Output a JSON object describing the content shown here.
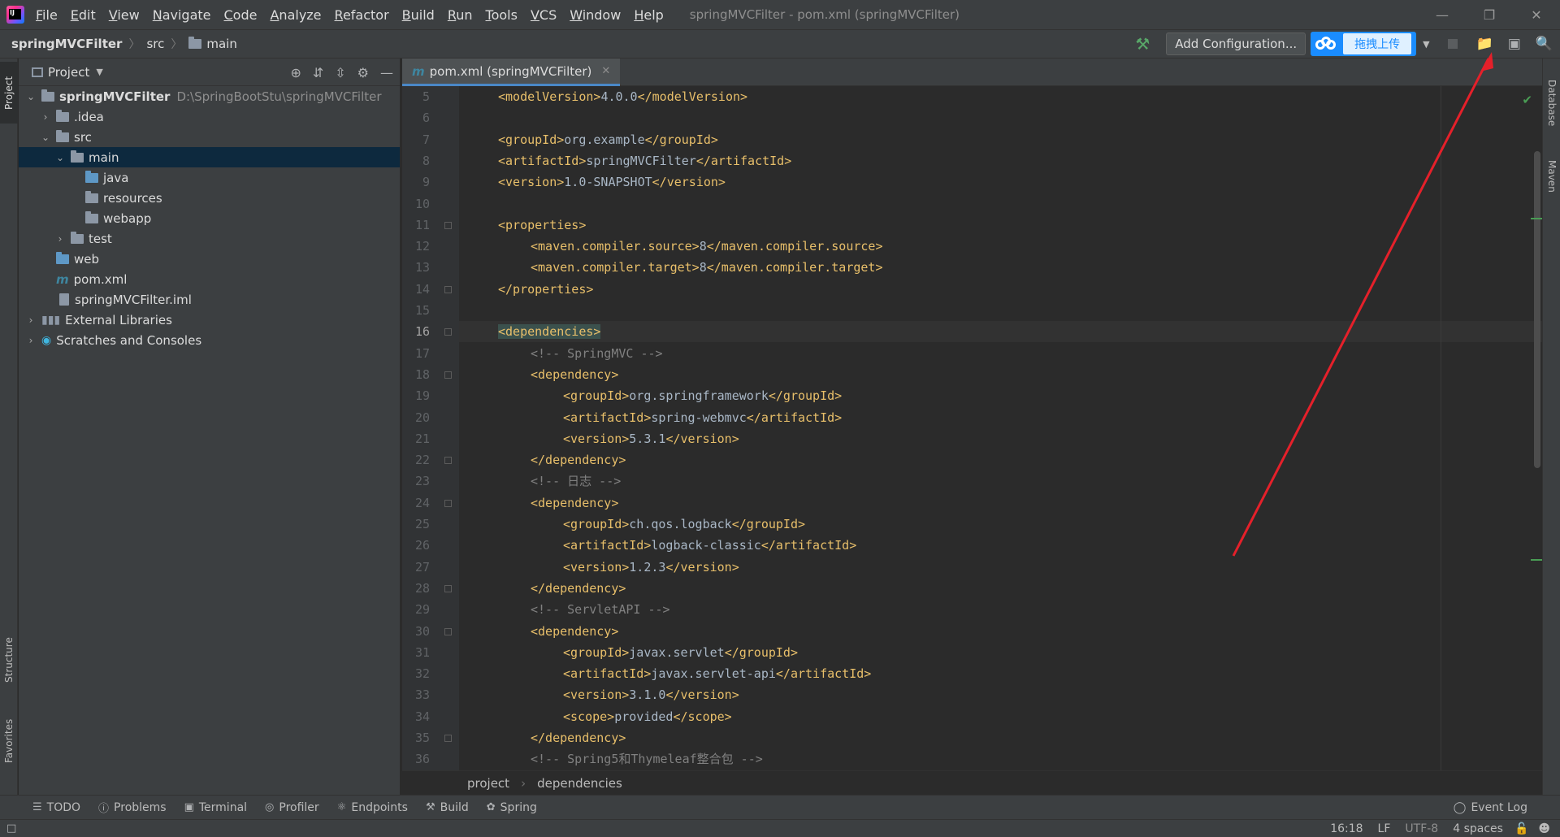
{
  "menu": {
    "items": [
      "File",
      "Edit",
      "View",
      "Navigate",
      "Code",
      "Analyze",
      "Refactor",
      "Build",
      "Run",
      "Tools",
      "VCS",
      "Window",
      "Help"
    ],
    "window_title": "springMVCFilter - pom.xml (springMVCFilter)"
  },
  "nav": {
    "project": "springMVCFilter",
    "src": "src",
    "main": "main"
  },
  "toolbar": {
    "add_config": "Add Configuration...",
    "baidu_upload": "拖拽上传"
  },
  "project_panel": {
    "title": "Project",
    "tree": [
      {
        "label": "springMVCFilter",
        "hint": "D:\\SpringBootStu\\springMVCFilter"
      },
      {
        "label": ".idea"
      },
      {
        "label": "src"
      },
      {
        "label": "main"
      },
      {
        "label": "java"
      },
      {
        "label": "resources"
      },
      {
        "label": "webapp"
      },
      {
        "label": "test"
      },
      {
        "label": "web"
      },
      {
        "label": "pom.xml"
      },
      {
        "label": "springMVCFilter.iml"
      },
      {
        "label": "External Libraries"
      },
      {
        "label": "Scratches and Consoles"
      }
    ]
  },
  "editor": {
    "tab": "pom.xml (springMVCFilter)",
    "current_line": 16,
    "lines": [
      {
        "n": "5",
        "indent": 1,
        "parts": [
          [
            "tag",
            "<modelVersion>"
          ],
          [
            "txt",
            "4.0.0"
          ],
          [
            "tag",
            "</modelVersion>"
          ]
        ]
      },
      {
        "n": "6",
        "indent": 0,
        "parts": []
      },
      {
        "n": "7",
        "indent": 1,
        "parts": [
          [
            "tag",
            "<groupId>"
          ],
          [
            "txt",
            "org.example"
          ],
          [
            "tag",
            "</groupId>"
          ]
        ]
      },
      {
        "n": "8",
        "indent": 1,
        "parts": [
          [
            "tag",
            "<artifactId>"
          ],
          [
            "txt",
            "springMVCFilter"
          ],
          [
            "tag",
            "</artifactId>"
          ]
        ]
      },
      {
        "n": "9",
        "indent": 1,
        "parts": [
          [
            "tag",
            "<version>"
          ],
          [
            "txt",
            "1.0-SNAPSHOT"
          ],
          [
            "tag",
            "</version>"
          ]
        ]
      },
      {
        "n": "10",
        "indent": 0,
        "parts": []
      },
      {
        "n": "11",
        "indent": 1,
        "parts": [
          [
            "tag",
            "<properties>"
          ]
        ]
      },
      {
        "n": "12",
        "indent": 2,
        "parts": [
          [
            "tag",
            "<maven.compiler.source>"
          ],
          [
            "txt",
            "8"
          ],
          [
            "tag",
            "</maven.compiler.source>"
          ]
        ]
      },
      {
        "n": "13",
        "indent": 2,
        "parts": [
          [
            "tag",
            "<maven.compiler.target>"
          ],
          [
            "txt",
            "8"
          ],
          [
            "tag",
            "</maven.compiler.target>"
          ]
        ]
      },
      {
        "n": "14",
        "indent": 1,
        "parts": [
          [
            "tag",
            "</properties>"
          ]
        ]
      },
      {
        "n": "15",
        "indent": 0,
        "parts": []
      },
      {
        "n": "16",
        "indent": 1,
        "parts": [
          [
            "taghl",
            "<dependencies>"
          ]
        ]
      },
      {
        "n": "17",
        "indent": 2,
        "parts": [
          [
            "cmt",
            "<!-- SpringMVC -->"
          ]
        ]
      },
      {
        "n": "18",
        "indent": 2,
        "parts": [
          [
            "tag",
            "<dependency>"
          ]
        ]
      },
      {
        "n": "19",
        "indent": 3,
        "parts": [
          [
            "tag",
            "<groupId>"
          ],
          [
            "txt",
            "org.springframework"
          ],
          [
            "tag",
            "</groupId>"
          ]
        ]
      },
      {
        "n": "20",
        "indent": 3,
        "parts": [
          [
            "tag",
            "<artifactId>"
          ],
          [
            "txt",
            "spring-webmvc"
          ],
          [
            "tag",
            "</artifactId>"
          ]
        ]
      },
      {
        "n": "21",
        "indent": 3,
        "parts": [
          [
            "tag",
            "<version>"
          ],
          [
            "txt",
            "5.3.1"
          ],
          [
            "tag",
            "</version>"
          ]
        ]
      },
      {
        "n": "22",
        "indent": 2,
        "parts": [
          [
            "tag",
            "</dependency>"
          ]
        ]
      },
      {
        "n": "23",
        "indent": 2,
        "parts": [
          [
            "cmt",
            "<!-- 日志 -->"
          ]
        ]
      },
      {
        "n": "24",
        "indent": 2,
        "parts": [
          [
            "tag",
            "<dependency>"
          ]
        ]
      },
      {
        "n": "25",
        "indent": 3,
        "parts": [
          [
            "tag",
            "<groupId>"
          ],
          [
            "txt",
            "ch.qos.logback"
          ],
          [
            "tag",
            "</groupId>"
          ]
        ]
      },
      {
        "n": "26",
        "indent": 3,
        "parts": [
          [
            "tag",
            "<artifactId>"
          ],
          [
            "txt",
            "logback-classic"
          ],
          [
            "tag",
            "</artifactId>"
          ]
        ]
      },
      {
        "n": "27",
        "indent": 3,
        "parts": [
          [
            "tag",
            "<version>"
          ],
          [
            "txt",
            "1.2.3"
          ],
          [
            "tag",
            "</version>"
          ]
        ]
      },
      {
        "n": "28",
        "indent": 2,
        "parts": [
          [
            "tag",
            "</dependency>"
          ]
        ]
      },
      {
        "n": "29",
        "indent": 2,
        "parts": [
          [
            "cmt",
            "<!-- ServletAPI -->"
          ]
        ]
      },
      {
        "n": "30",
        "indent": 2,
        "parts": [
          [
            "tag",
            "<dependency>"
          ]
        ]
      },
      {
        "n": "31",
        "indent": 3,
        "parts": [
          [
            "tag",
            "<groupId>"
          ],
          [
            "txt",
            "javax.servlet"
          ],
          [
            "tag",
            "</groupId>"
          ]
        ]
      },
      {
        "n": "32",
        "indent": 3,
        "parts": [
          [
            "tag",
            "<artifactId>"
          ],
          [
            "txt",
            "javax.servlet-api"
          ],
          [
            "tag",
            "</artifactId>"
          ]
        ]
      },
      {
        "n": "33",
        "indent": 3,
        "parts": [
          [
            "tag",
            "<version>"
          ],
          [
            "txt",
            "3.1.0"
          ],
          [
            "tag",
            "</version>"
          ]
        ]
      },
      {
        "n": "34",
        "indent": 3,
        "parts": [
          [
            "tag",
            "<scope>"
          ],
          [
            "txt",
            "provided"
          ],
          [
            "tag",
            "</scope>"
          ]
        ]
      },
      {
        "n": "35",
        "indent": 2,
        "parts": [
          [
            "tag",
            "</dependency>"
          ]
        ]
      },
      {
        "n": "36",
        "indent": 2,
        "parts": [
          [
            "cmt",
            "<!-- Spring5和Thymeleaf整合包 -->"
          ]
        ]
      }
    ],
    "breadcrumb": [
      "project",
      "dependencies"
    ]
  },
  "left_stripe": {
    "project": "Project",
    "structure": "Structure",
    "favorites": "Favorites"
  },
  "right_stripe": {
    "database": "Database",
    "maven": "Maven"
  },
  "bottom_tools": [
    "TODO",
    "Problems",
    "Terminal",
    "Profiler",
    "Endpoints",
    "Build",
    "Spring"
  ],
  "event_log": "Event Log",
  "status": {
    "position": "16:18",
    "line_sep": "LF",
    "encoding": "UTF-8",
    "indent": "4 spaces"
  },
  "colors": {
    "annotation_arrow": "#e5202a",
    "tag": "#e8bf6a",
    "comment": "#808080",
    "selection": "#0d293e"
  }
}
